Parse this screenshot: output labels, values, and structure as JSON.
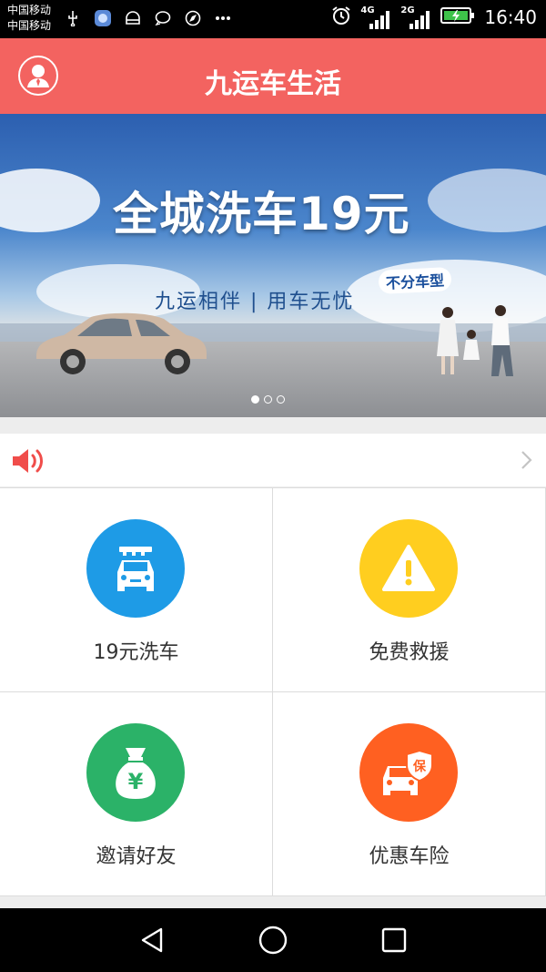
{
  "status_bar": {
    "carrier_1": "中国移动",
    "carrier_2": "中国移动",
    "network_1": "4G",
    "network_2": "2G",
    "time": "16:40"
  },
  "header": {
    "title": "九运车生活"
  },
  "banner": {
    "headline": "全城洗车19元",
    "tag": "不分车型",
    "slogan": "九运相伴 | 用车无忧",
    "slide_count": 3,
    "active_slide": 1
  },
  "notice": {
    "text": ""
  },
  "features": [
    {
      "label": "19元洗车",
      "icon": "car-wash-icon",
      "color": "#1e9be6"
    },
    {
      "label": "免费救援",
      "icon": "warning-icon",
      "color": "#ffce1f"
    },
    {
      "label": "邀请好友",
      "icon": "money-bag-icon",
      "color": "#2bb268"
    },
    {
      "label": "优惠车险",
      "icon": "car-insurance-icon",
      "color": "#ff6021"
    }
  ],
  "colors": {
    "header": "#f36360",
    "accent_red": "#f04d4a"
  }
}
